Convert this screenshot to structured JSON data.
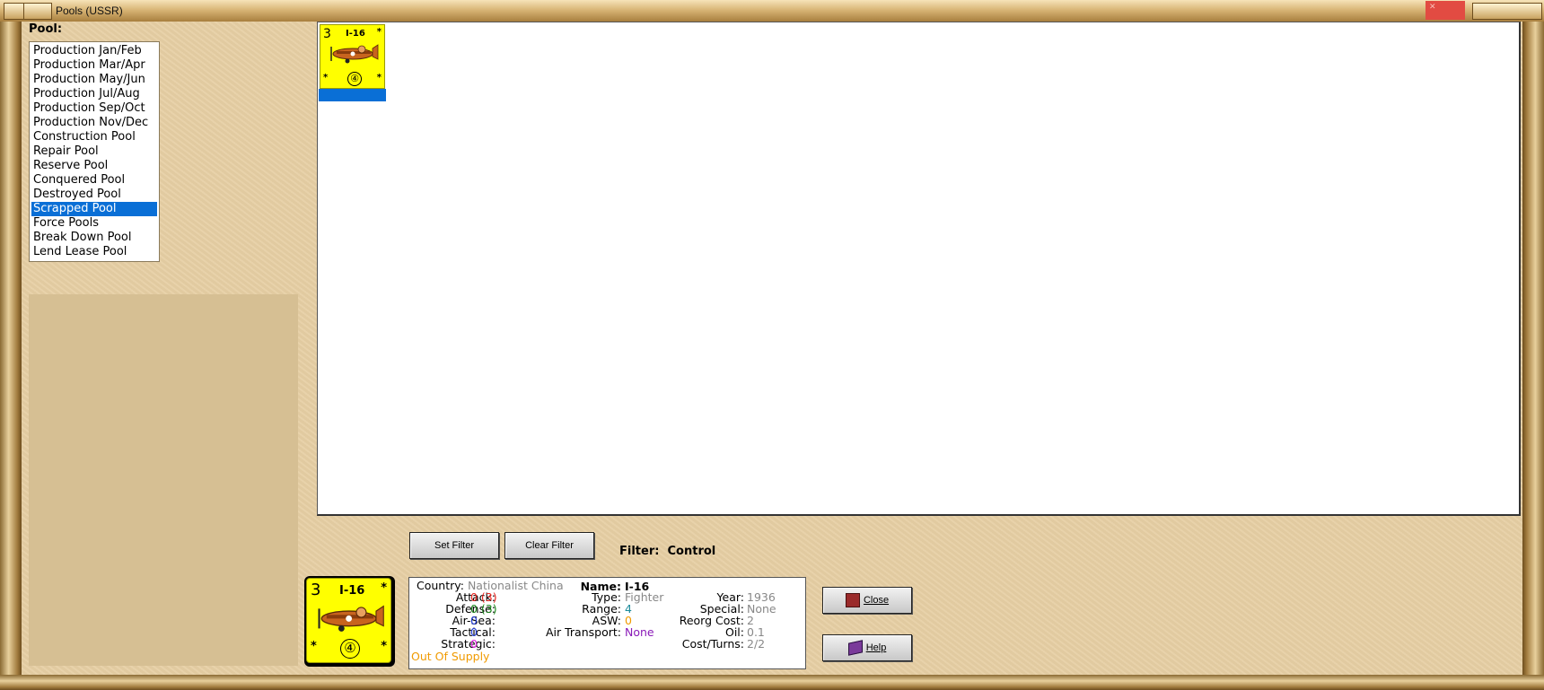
{
  "window": {
    "title": "Pools (USSR)"
  },
  "pool": {
    "label": "Pool:",
    "items": [
      "Production Jan/Feb",
      "Production Mar/Apr",
      "Production May/Jun",
      "Production Jul/Aug",
      "Production Sep/Oct",
      "Production Nov/Dec",
      "Construction Pool",
      "Repair Pool",
      "Reserve Pool",
      "Conquered Pool",
      "Destroyed Pool",
      "Scrapped Pool",
      "Force Pools",
      "Break Down Pool",
      "Lend Lease Pool"
    ],
    "selected": "Scrapped Pool"
  },
  "unit_counter": {
    "strength": "3",
    "name": "I-16",
    "movement": "④",
    "corner_mark": "*"
  },
  "filter": {
    "set_label": "Set Filter",
    "clear_label": "Clear Filter",
    "label": "Filter:",
    "value": "Control"
  },
  "details": {
    "country": {
      "label": "Country:",
      "value": "Nationalist China"
    },
    "attack": {
      "label": "Attack:",
      "value": "0 (3)"
    },
    "defense": {
      "label": "Defense:",
      "value": "0 (3)"
    },
    "air_sea": {
      "label": "Air-Sea:",
      "value": "0"
    },
    "tactical": {
      "label": "Tactical:",
      "value": "0"
    },
    "strategic": {
      "label": "Strategic:",
      "value": "0"
    },
    "status": "Out Of Supply",
    "name": {
      "label": "Name:",
      "value": "I-16"
    },
    "type": {
      "label": "Type:",
      "value": "Fighter"
    },
    "range": {
      "label": "Range:",
      "value": "4"
    },
    "asw": {
      "label": "ASW:",
      "value": "0"
    },
    "air_transport": {
      "label": "Air Transport:",
      "value": "None"
    },
    "year": {
      "label": "Year:",
      "value": "1936"
    },
    "special": {
      "label": "Special:",
      "value": "None"
    },
    "reorg_cost": {
      "label": "Reorg Cost:",
      "value": "2"
    },
    "oil": {
      "label": "Oil:",
      "value": "0.1"
    },
    "cost_turns": {
      "label": "Cost/Turns:",
      "value": "2/2"
    }
  },
  "buttons": {
    "close_label": "Close",
    "help_label": "Help"
  },
  "colors": {
    "selection": "#0a6fd6",
    "counter_yellow": "#ffff00",
    "titlebar_close": "#e24b42"
  }
}
